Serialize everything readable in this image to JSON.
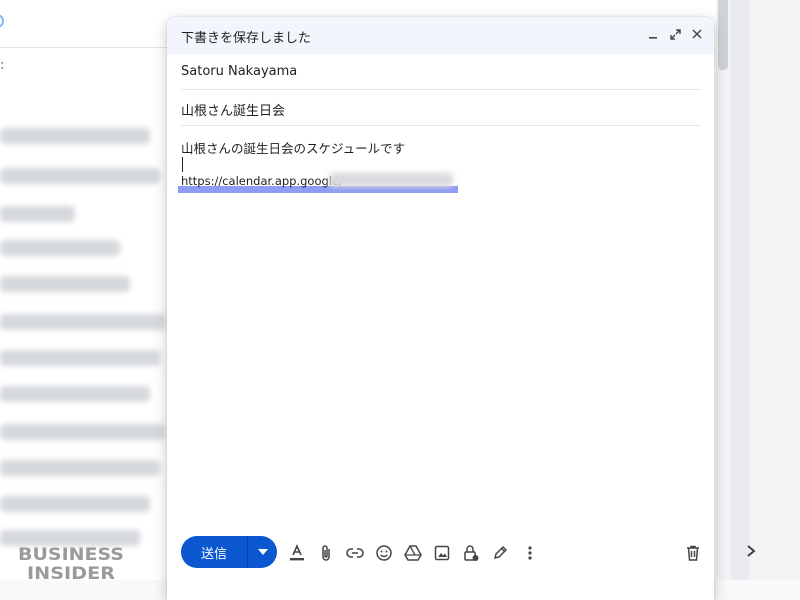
{
  "compose": {
    "title": "下書きを保存しました",
    "to": "Satoru Nakayama",
    "subject": "山根さん誕生日会",
    "body_line1": "山根さんの誕生日会のスケジュールです",
    "body_url": "https://calendar.app.google/",
    "send_label": "送信"
  },
  "background": {
    "colon": ":"
  },
  "toolbar": {
    "icons": [
      "format-text-icon",
      "attach-icon",
      "link-icon",
      "emoji-icon",
      "drive-icon",
      "photo-icon",
      "confidential-lock-icon",
      "signature-pen-icon",
      "more-options-icon"
    ]
  },
  "watermark": {
    "line1": "BUSINESS",
    "line2": "INSIDER"
  },
  "colors": {
    "send": "#0b57d0",
    "header_bg": "#f2f6fc",
    "highlight": "#8e9cf3"
  }
}
